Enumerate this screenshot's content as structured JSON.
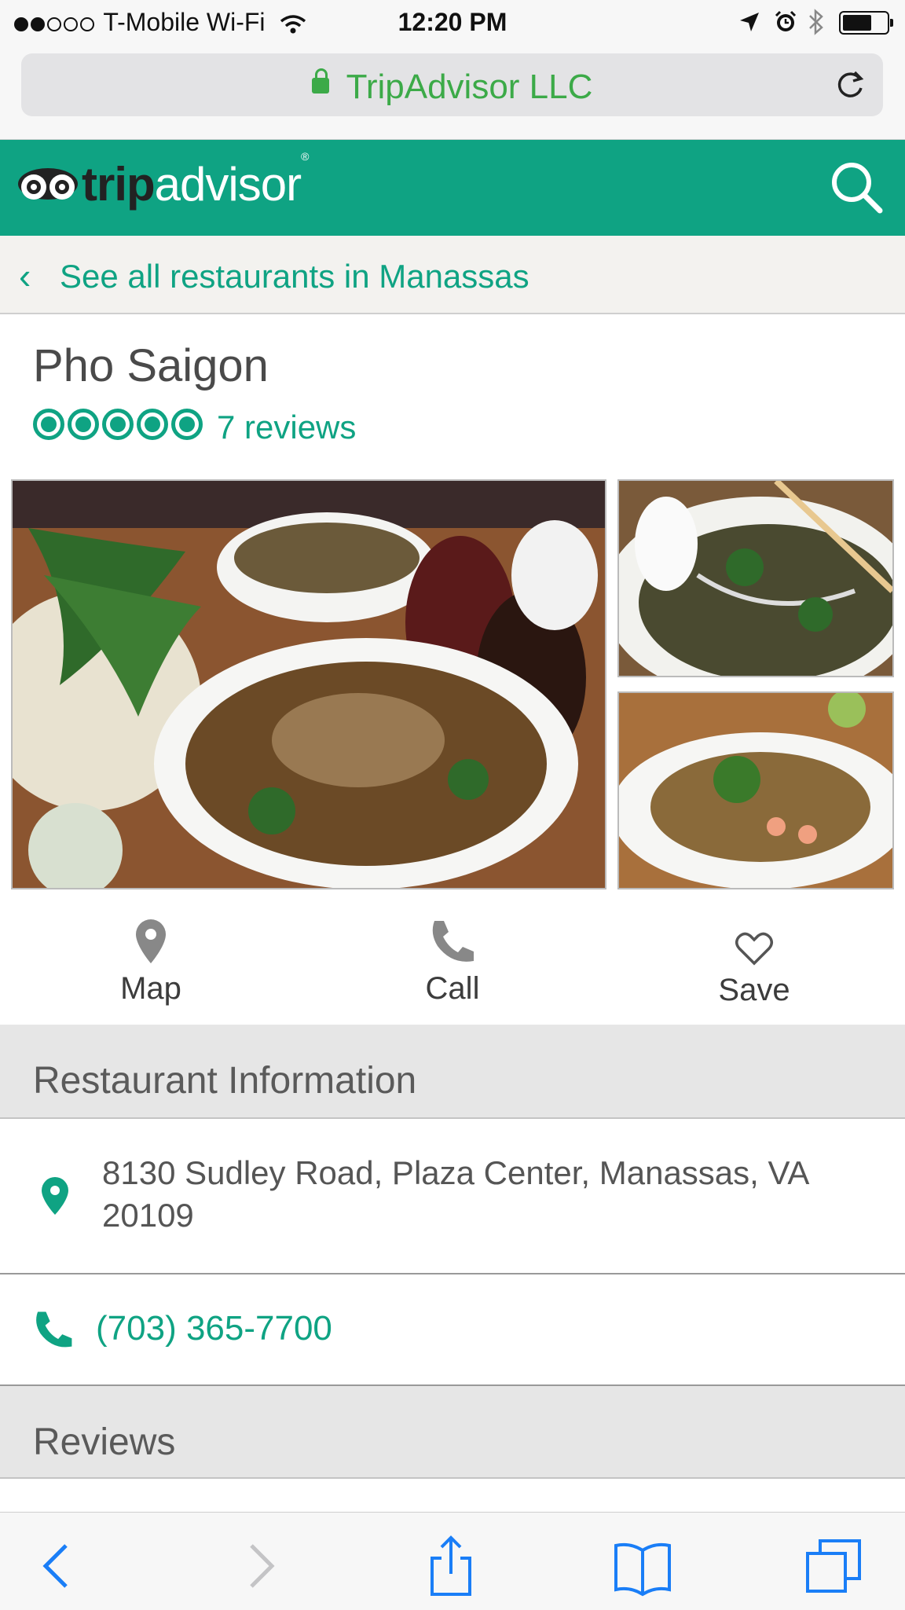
{
  "status_bar": {
    "carrier": "T-Mobile Wi-Fi",
    "time": "12:20 PM"
  },
  "browser": {
    "url_title": "TripAdvisor LLC"
  },
  "header": {
    "logo_trip": "trip",
    "logo_advisor": "advisor"
  },
  "breadcrumb": {
    "label": "See all restaurants in Manassas"
  },
  "restaurant": {
    "name": "Pho Saigon",
    "rating_bubbles": 5,
    "reviews_label": "7 reviews"
  },
  "actions": {
    "map": "Map",
    "call": "Call",
    "save": "Save"
  },
  "info_section": {
    "title": "Restaurant Information",
    "address": "8130 Sudley Road, Plaza Center, Manassas, VA 20109",
    "phone": "(703) 365-7700"
  },
  "reviews_section": {
    "title": "Reviews"
  },
  "colors": {
    "brand_green": "#0fa383",
    "url_green": "#3caa48"
  }
}
